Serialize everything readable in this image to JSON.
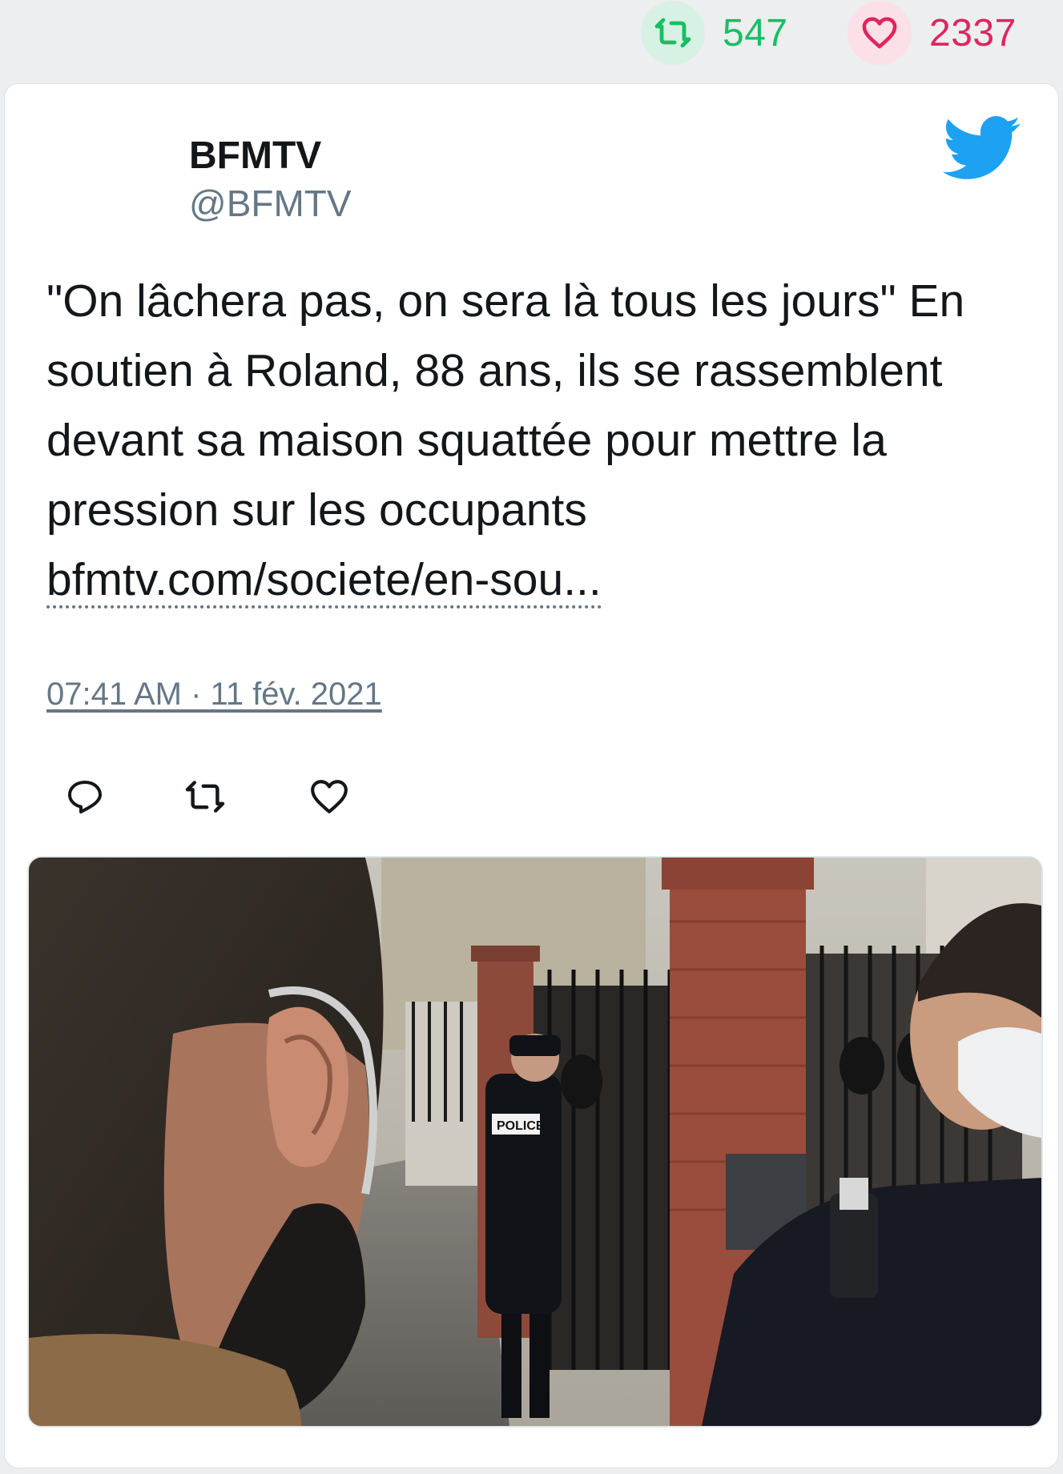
{
  "stats": {
    "retweets": "547",
    "likes": "2337",
    "retweet_icon": "retweet-icon",
    "like_icon": "heart-icon",
    "retweet_color": "#17bf63",
    "like_color": "#e0245e"
  },
  "tweet": {
    "author_name": "BFMTV",
    "author_handle": "@BFMTV",
    "text_body": "\"On lâchera pas, on sera là tous les jours\" En soutien à Roland, 88 ans, ils se rassemblent devant sa maison squattée pour mettre la pression sur les occupants ",
    "link": "bfmtv.com/societe/en-sou...",
    "timestamp": "07:41 AM · 11 fév. 2021",
    "brand_color": "#1da1f2",
    "brand_icon": "twitter-bird-icon"
  },
  "actions": {
    "reply_icon": "reply-icon",
    "retweet_icon": "retweet-icon",
    "like_icon": "heart-icon"
  },
  "media": {
    "police_label": "POLICE"
  }
}
